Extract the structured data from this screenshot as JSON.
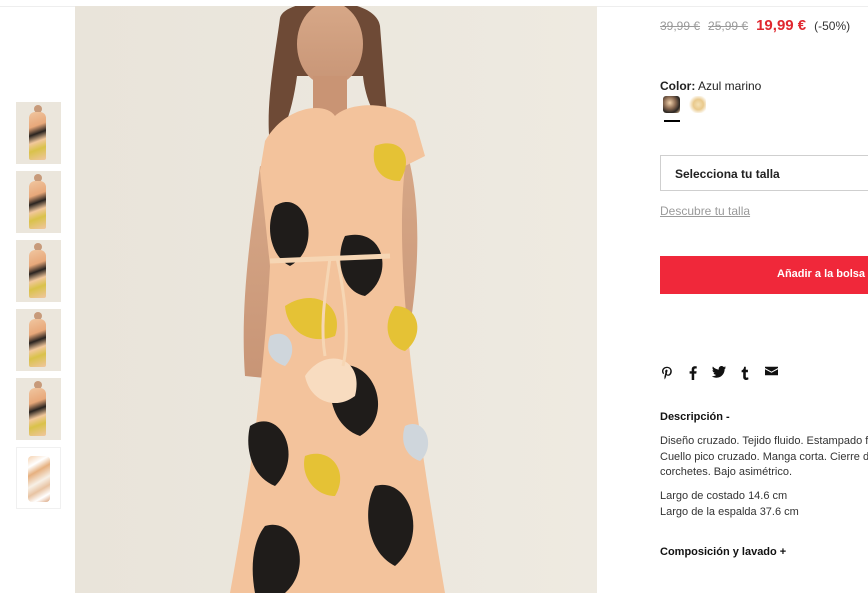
{
  "gallery": {
    "thumbnail_count": 6,
    "main_image_alt": "Vestido cruzado estampado floral"
  },
  "price": {
    "original_1": "39,99 €",
    "original_2": "25,99 €",
    "current": "19,99 €",
    "discount": "(-50%)",
    "accent_color": "#e0272f"
  },
  "color": {
    "label": "Color:",
    "value": "Azul marino",
    "swatches": [
      "floral-navy",
      "floral-cream"
    ]
  },
  "size": {
    "select_label": "Selecciona tu talla",
    "guide_link": "Descubre tu talla"
  },
  "cart": {
    "add_label": "Añadir a la bolsa",
    "button_color": "#f0283a"
  },
  "share": {
    "icons": [
      "pinterest-icon",
      "facebook-icon",
      "twitter-icon",
      "tumblr-icon",
      "email-icon"
    ]
  },
  "description": {
    "heading": "Descripción -",
    "text": "Diseño cruzado. Tejido fluido. Estampado floral. Cuello pico cruzado. Manga corta. Cierre de corchetes. Bajo asimétrico.",
    "measure_1": "Largo de costado 14.6 cm",
    "measure_2": "Largo de la espalda 37.6 cm"
  },
  "composition": {
    "heading": "Composición y lavado +"
  }
}
